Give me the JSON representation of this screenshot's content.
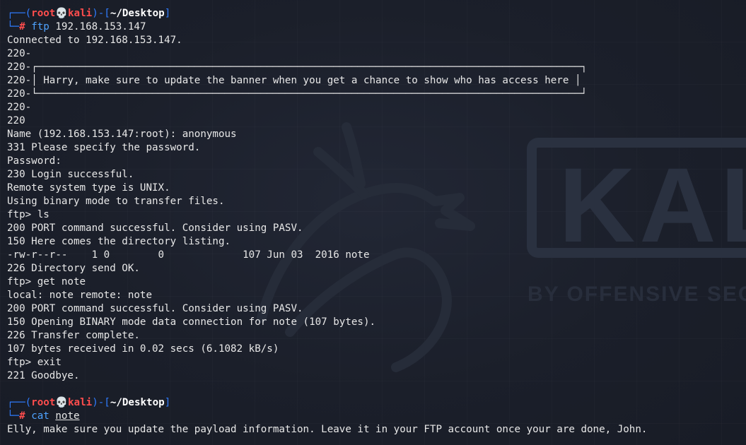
{
  "background": {
    "logo_text": "KALI",
    "logo_subtitle": "BY OFFENSIVE SECU"
  },
  "prompt1": {
    "user": "root",
    "skull": "💀",
    "host": "kali",
    "path": "~/Desktop",
    "cmd": "ftp",
    "arg": "192.168.153.147"
  },
  "output": [
    "Connected to 192.168.153.147.",
    "220-",
    "220-┌──────────────────────────────────────────────────────────────────────────────────────────┐",
    "220-│ Harry, make sure to update the banner when you get a chance to show who has access here │",
    "220-└──────────────────────────────────────────────────────────────────────────────────────────┘",
    "220-",
    "220",
    "Name (192.168.153.147:root): anonymous",
    "331 Please specify the password.",
    "Password:",
    "230 Login successful.",
    "Remote system type is UNIX.",
    "Using binary mode to transfer files.",
    "ftp> ls",
    "200 PORT command successful. Consider using PASV.",
    "150 Here comes the directory listing.",
    "-rw-r--r--    1 0        0             107 Jun 03  2016 note",
    "226 Directory send OK.",
    "ftp> get note",
    "local: note remote: note",
    "200 PORT command successful. Consider using PASV.",
    "150 Opening BINARY mode data connection for note (107 bytes).",
    "226 Transfer complete.",
    "107 bytes received in 0.02 secs (6.1082 kB/s)",
    "ftp> exit",
    "221 Goodbye."
  ],
  "prompt2": {
    "user": "root",
    "skull": "💀",
    "host": "kali",
    "path": "~/Desktop",
    "cmd": "cat",
    "arg": "note"
  },
  "final_output": "Elly, make sure you update the payload information. Leave it in your FTP account once your are done, John."
}
